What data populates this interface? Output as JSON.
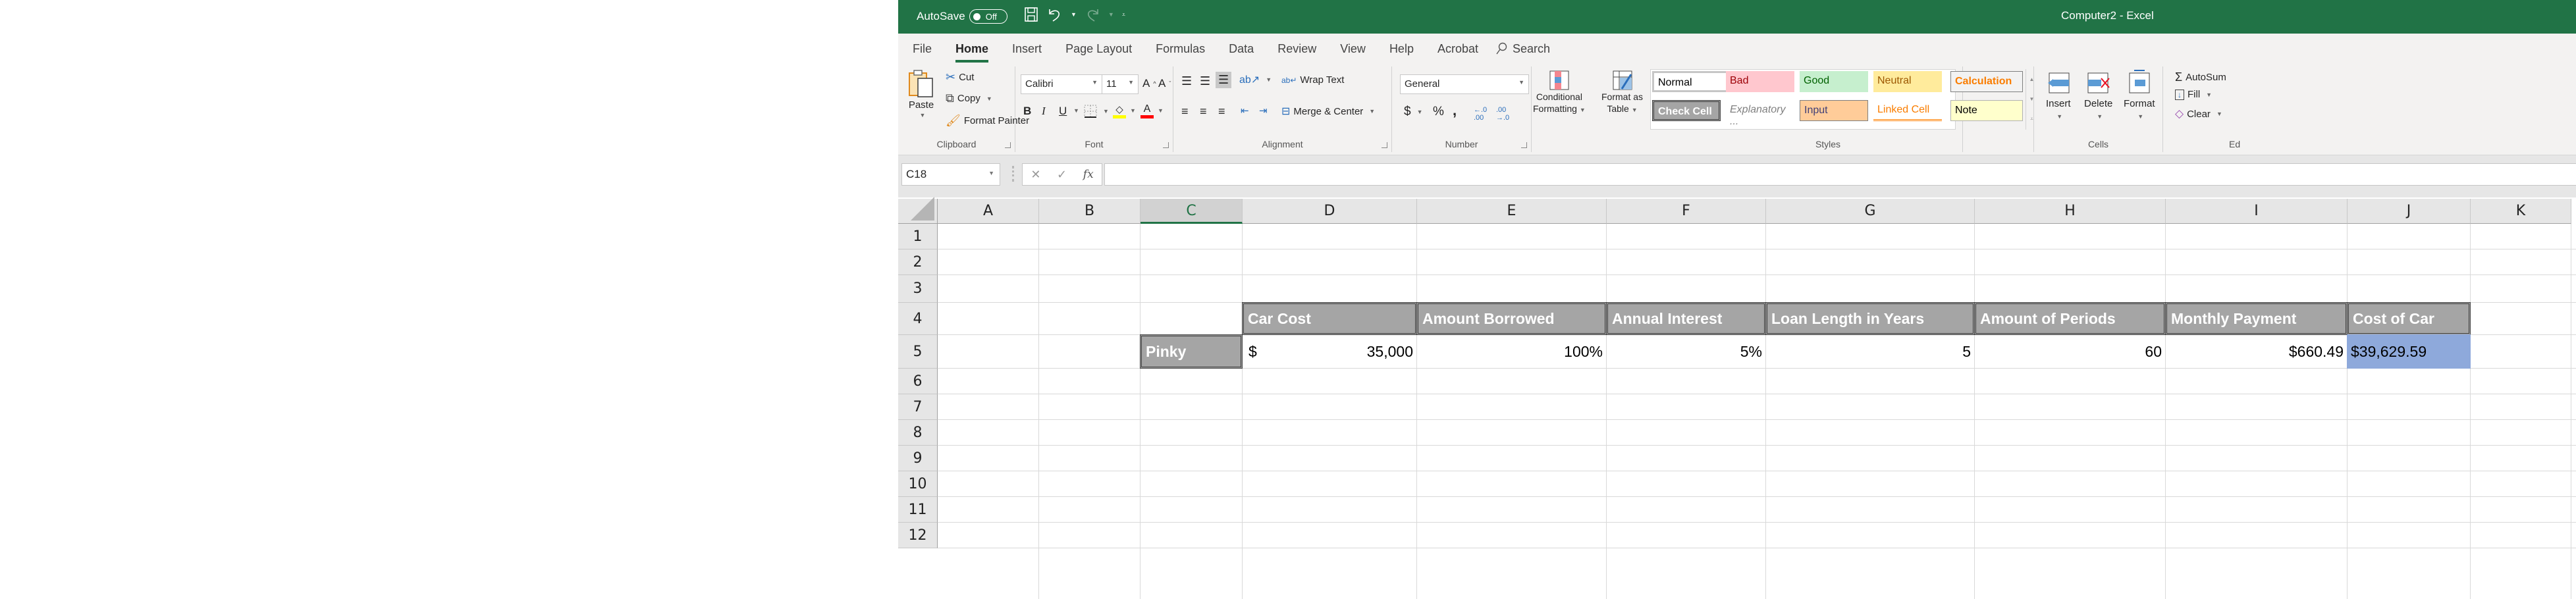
{
  "titlebar": {
    "autosave_label": "AutoSave",
    "autosave_state": "Off",
    "doc_title": "Computer2  -  Excel",
    "accent_color": "#217346"
  },
  "tabs": [
    {
      "label": "File"
    },
    {
      "label": "Home",
      "active": true
    },
    {
      "label": "Insert"
    },
    {
      "label": "Page Layout"
    },
    {
      "label": "Formulas"
    },
    {
      "label": "Data"
    },
    {
      "label": "Review"
    },
    {
      "label": "View"
    },
    {
      "label": "Help"
    },
    {
      "label": "Acrobat"
    }
  ],
  "search_label": "Search",
  "ribbon": {
    "clipboard": {
      "label": "Clipboard",
      "paste": "Paste",
      "cut": "Cut",
      "copy": "Copy",
      "format_painter": "Format Painter"
    },
    "font": {
      "label": "Font",
      "font_name": "Calibri",
      "font_size": "11",
      "bold": "B",
      "italic": "I",
      "underline": "U",
      "fill_color": "#ffff00",
      "font_color": "#ff0000"
    },
    "alignment": {
      "label": "Alignment",
      "wrap_text": "Wrap Text",
      "merge_center": "Merge & Center"
    },
    "number": {
      "label": "Number",
      "format": "General",
      "currency": "$",
      "percent": "%",
      "comma": ","
    },
    "styles": {
      "label": "Styles",
      "conditional_formatting": [
        "Conditional",
        "Formatting"
      ],
      "format_as_table": [
        "Format as",
        "Table"
      ],
      "gallery": [
        {
          "label": "Normal",
          "bg": "#ffffff",
          "fg": "#000000"
        },
        {
          "label": "Bad",
          "bg": "#ffc7ce",
          "fg": "#9c0006"
        },
        {
          "label": "Good",
          "bg": "#c6efce",
          "fg": "#006100"
        },
        {
          "label": "Neutral",
          "bg": "#ffeb9c",
          "fg": "#9c5700"
        },
        {
          "label": "Calculation",
          "bg": "#f2f2f2",
          "fg": "#fa7d00"
        },
        {
          "label": "Check Cell",
          "bg": "#a5a5a5",
          "fg": "#ffffff"
        },
        {
          "label": "Explanatory ...",
          "bg": "transparent",
          "fg": "#7f7f7f"
        },
        {
          "label": "Input",
          "bg": "#ffcc99",
          "fg": "#3f3f76"
        },
        {
          "label": "Linked Cell",
          "bg": "transparent",
          "fg": "#fa7d00"
        },
        {
          "label": "Note",
          "bg": "#ffffcc",
          "fg": "#000000"
        }
      ]
    },
    "cells": {
      "label": "Cells",
      "insert": "Insert",
      "delete": "Delete",
      "format": "Format"
    },
    "editing": {
      "label": "Ed",
      "autosum": "AutoSum",
      "fill": "Fill",
      "clear": "Clear"
    }
  },
  "formula_bar": {
    "name_box": "C18",
    "formula": ""
  },
  "sheet": {
    "columns": [
      "A",
      "B",
      "C",
      "D",
      "E",
      "F",
      "G",
      "H",
      "I",
      "J",
      "K"
    ],
    "selected_column": "C",
    "rows": [
      "1",
      "2",
      "3",
      "4",
      "5",
      "6",
      "7",
      "8",
      "9",
      "10",
      "11",
      "12"
    ],
    "headers_row4": [
      "Car Cost",
      "Amount Borrowed",
      "Annual Interest",
      "Loan Length in Years",
      "Amount of Periods",
      "Monthly Payment",
      "Cost of Car"
    ],
    "row5": {
      "label": "Pinky",
      "car_cost_symbol": "$",
      "car_cost": "35,000",
      "amount_borrowed": "100%",
      "annual_interest": "5%",
      "loan_length_years": "5",
      "amount_of_periods": "60",
      "monthly_payment": "$660.49",
      "cost_of_car": "$39,629.59"
    },
    "check_cell_color": "#a5a5a5",
    "highlight_color": "#8ea9db"
  }
}
